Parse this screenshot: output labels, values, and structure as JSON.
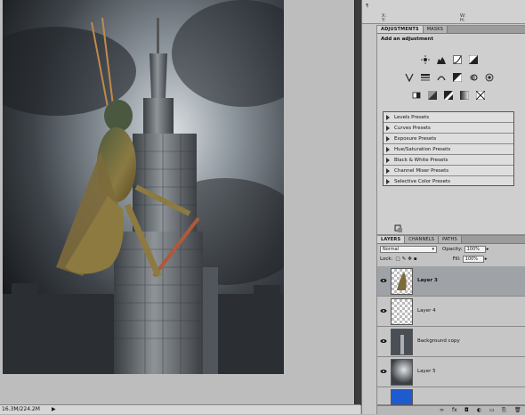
{
  "status_bar": {
    "zoom": "16.3M/224.2M",
    "nav_icon": "right-arrow-icon"
  },
  "info_panel": {
    "label_a": "X:",
    "label_b": "Y:",
    "label_c": "W:",
    "label_d": "H:"
  },
  "adjustments": {
    "tabs": [
      "ADJUSTMENTS",
      "MASKS"
    ],
    "heading": "Add an adjustment",
    "icon_rows": [
      [
        "brightness-icon",
        "levels-icon",
        "curves-icon",
        "exposure-icon"
      ],
      [
        "vibrance-icon",
        "hue-saturation-icon",
        "color-balance-icon",
        "black-white-icon",
        "photo-filter-icon",
        "channel-mixer-icon"
      ],
      [
        "invert-icon",
        "posterize-icon",
        "threshold-icon",
        "gradient-map-icon",
        "selective-color-icon"
      ]
    ],
    "presets": [
      "Levels Presets",
      "Curves Presets",
      "Exposure Presets",
      "Hue/Saturation Presets",
      "Black & White Presets",
      "Channel Mixer Presets",
      "Selective Color Presets"
    ]
  },
  "layers_panel": {
    "tabs": [
      "LAYERS",
      "CHANNELS",
      "PATHS"
    ],
    "blend_mode": "Normal",
    "opacity_label": "Opacity:",
    "opacity_value": "100%",
    "lock_label": "Lock:",
    "fill_label": "Fill:",
    "fill_value": "100%",
    "layers": [
      {
        "name": "Layer 3",
        "selected": true
      },
      {
        "name": "Layer 4",
        "selected": false
      },
      {
        "name": "Background copy",
        "selected": false
      },
      {
        "name": "Layer 5",
        "selected": false
      }
    ],
    "footer_icons": [
      "link-icon",
      "fx-icon",
      "mask-icon",
      "adjustment-layer-icon",
      "group-icon",
      "new-layer-icon",
      "trash-icon"
    ]
  },
  "colors": {
    "accent": "#1f5bd0",
    "panel": "#c8c8c8",
    "selected_layer": "#9fa3a8"
  }
}
